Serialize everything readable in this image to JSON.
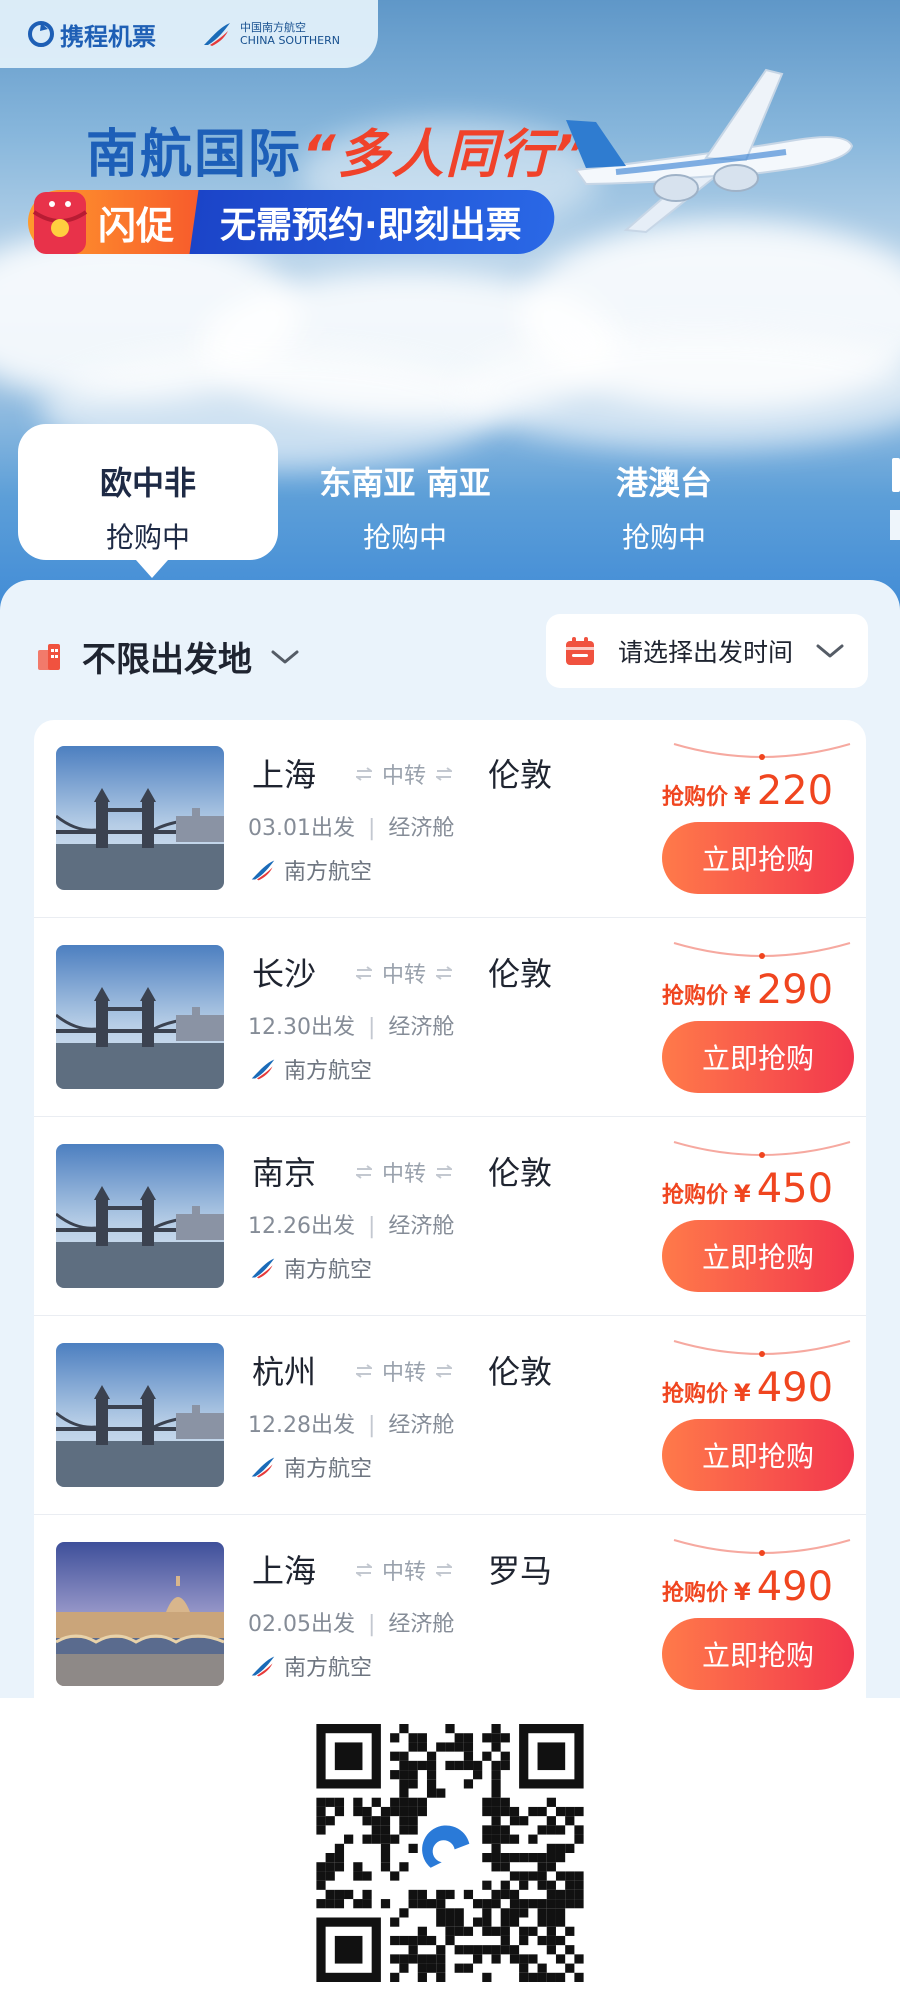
{
  "brand": {
    "ctrip": "携程机票",
    "cs_cn": "中国南方航空",
    "cs_en": "CHINA SOUTHERN"
  },
  "hero": {
    "title": "南航国际",
    "highlight": "“多人同行”",
    "flash_label": "闪促",
    "slogan": "无需预约·即刻出票"
  },
  "tabs": [
    {
      "name": "欧中非",
      "status": "抢购中",
      "active": true
    },
    {
      "name": "东南亚 南亚",
      "status": "抢购中",
      "active": false
    },
    {
      "name": "港澳台",
      "status": "抢购中",
      "active": false
    }
  ],
  "filters": {
    "origin": "不限出发地",
    "date_placeholder": "请选择出发时间"
  },
  "flights": [
    {
      "from": "上海",
      "transfer": "中转",
      "to": "伦敦",
      "date": "03.01出发",
      "cabin": "经济舱",
      "airline": "南方航空",
      "price_label": "抢购价",
      "currency": "¥",
      "price": "220",
      "button": "立即抢购",
      "image": "london-tower-bridge"
    },
    {
      "from": "长沙",
      "transfer": "中转",
      "to": "伦敦",
      "date": "12.30出发",
      "cabin": "经济舱",
      "airline": "南方航空",
      "price_label": "抢购价",
      "currency": "¥",
      "price": "290",
      "button": "立即抢购",
      "image": "london-tower-bridge"
    },
    {
      "from": "南京",
      "transfer": "中转",
      "to": "伦敦",
      "date": "12.26出发",
      "cabin": "经济舱",
      "airline": "南方航空",
      "price_label": "抢购价",
      "currency": "¥",
      "price": "450",
      "button": "立即抢购",
      "image": "london-tower-bridge"
    },
    {
      "from": "杭州",
      "transfer": "中转",
      "to": "伦敦",
      "date": "12.28出发",
      "cabin": "经济舱",
      "airline": "南方航空",
      "price_label": "抢购价",
      "currency": "¥",
      "price": "490",
      "button": "立即抢购",
      "image": "london-tower-bridge"
    },
    {
      "from": "上海",
      "transfer": "中转",
      "to": "罗马",
      "date": "02.05出发",
      "cabin": "经济舱",
      "airline": "南方航空",
      "price_label": "抢购价",
      "currency": "¥",
      "price": "490",
      "button": "立即抢购",
      "image": "rome-st-peters"
    }
  ],
  "colors": {
    "accent": "#f0451f",
    "button_start": "#ff7a4a",
    "button_end": "#f2374d",
    "brand_blue": "#1d5fb8"
  },
  "icons": {
    "origin": "building-icon",
    "date": "calendar-icon",
    "dropdown": "chevron-down-icon",
    "transfer": "transfer-arrows-icon",
    "airline": "china-southern-logo-icon"
  }
}
